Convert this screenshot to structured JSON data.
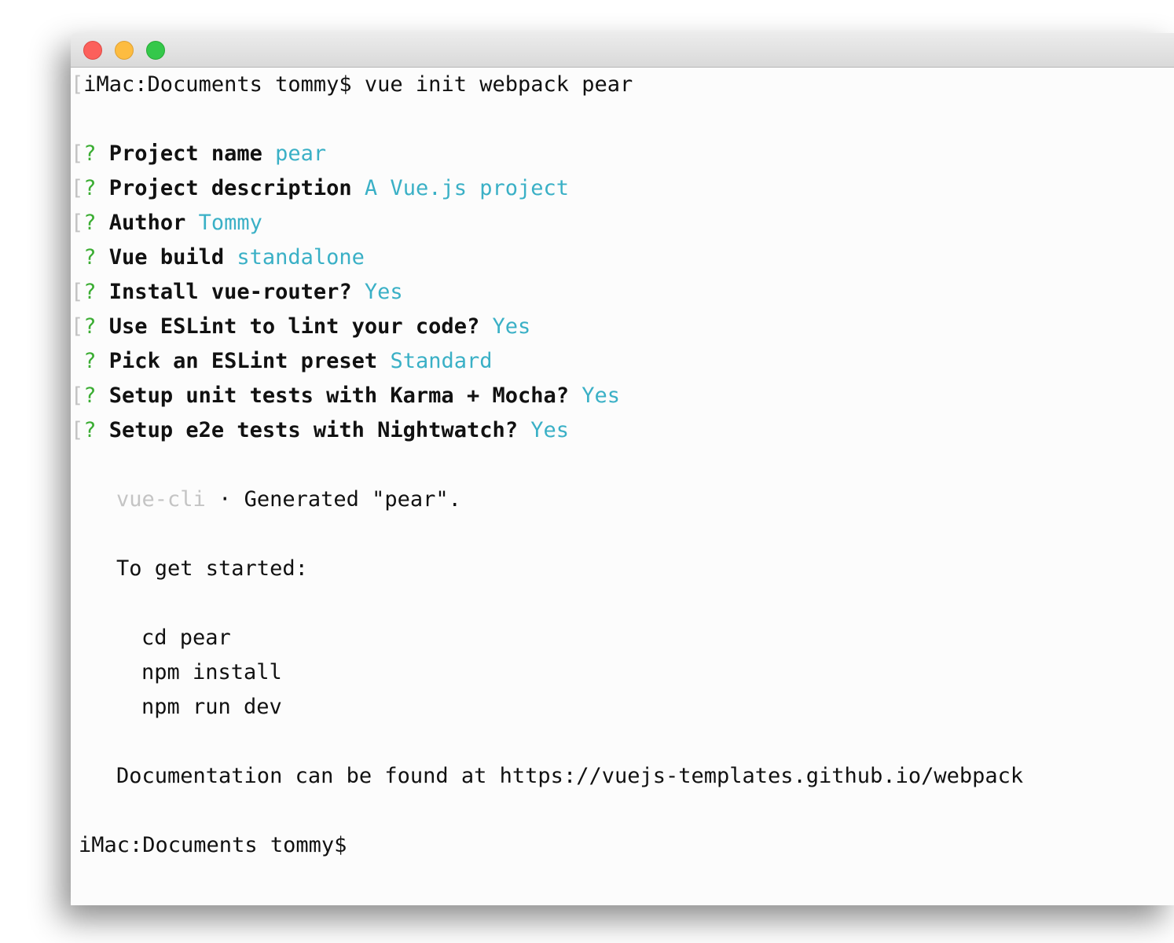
{
  "terminal": {
    "prompt_command": {
      "prompt": "iMac:Documents tommy$",
      "command": "vue init webpack pear"
    },
    "questions": [
      {
        "bracket": true,
        "mark": "?",
        "label": "Project name",
        "answer": "pear"
      },
      {
        "bracket": true,
        "mark": "?",
        "label": "Project description",
        "answer": "A Vue.js project"
      },
      {
        "bracket": true,
        "mark": "?",
        "label": "Author",
        "answer": "Tommy"
      },
      {
        "bracket": false,
        "mark": "?",
        "label": "Vue build",
        "answer": "standalone"
      },
      {
        "bracket": true,
        "mark": "?",
        "label": "Install vue-router?",
        "answer": "Yes"
      },
      {
        "bracket": true,
        "mark": "?",
        "label": "Use ESLint to lint your code?",
        "answer": "Yes"
      },
      {
        "bracket": false,
        "mark": "?",
        "label": "Pick an ESLint preset",
        "answer": "Standard"
      },
      {
        "bracket": true,
        "mark": "?",
        "label": "Setup unit tests with Karma + Mocha?",
        "answer": "Yes"
      },
      {
        "bracket": true,
        "mark": "?",
        "label": "Setup e2e tests with Nightwatch?",
        "answer": "Yes"
      }
    ],
    "bracket_char": "[",
    "generated": {
      "source": "vue-cli",
      "separator": "·",
      "message": "Generated \"pear\"."
    },
    "get_started": "To get started:",
    "commands": [
      "cd pear",
      "npm install",
      "npm run dev"
    ],
    "documentation": "Documentation can be found at https://vuejs-templates.github.io/webpack",
    "final_prompt": "iMac:Documents tommy$"
  },
  "colors": {
    "question_mark": "#3bad33",
    "answer": "#3ab0c6",
    "dim": "#c4c4c4",
    "text": "#111111"
  }
}
